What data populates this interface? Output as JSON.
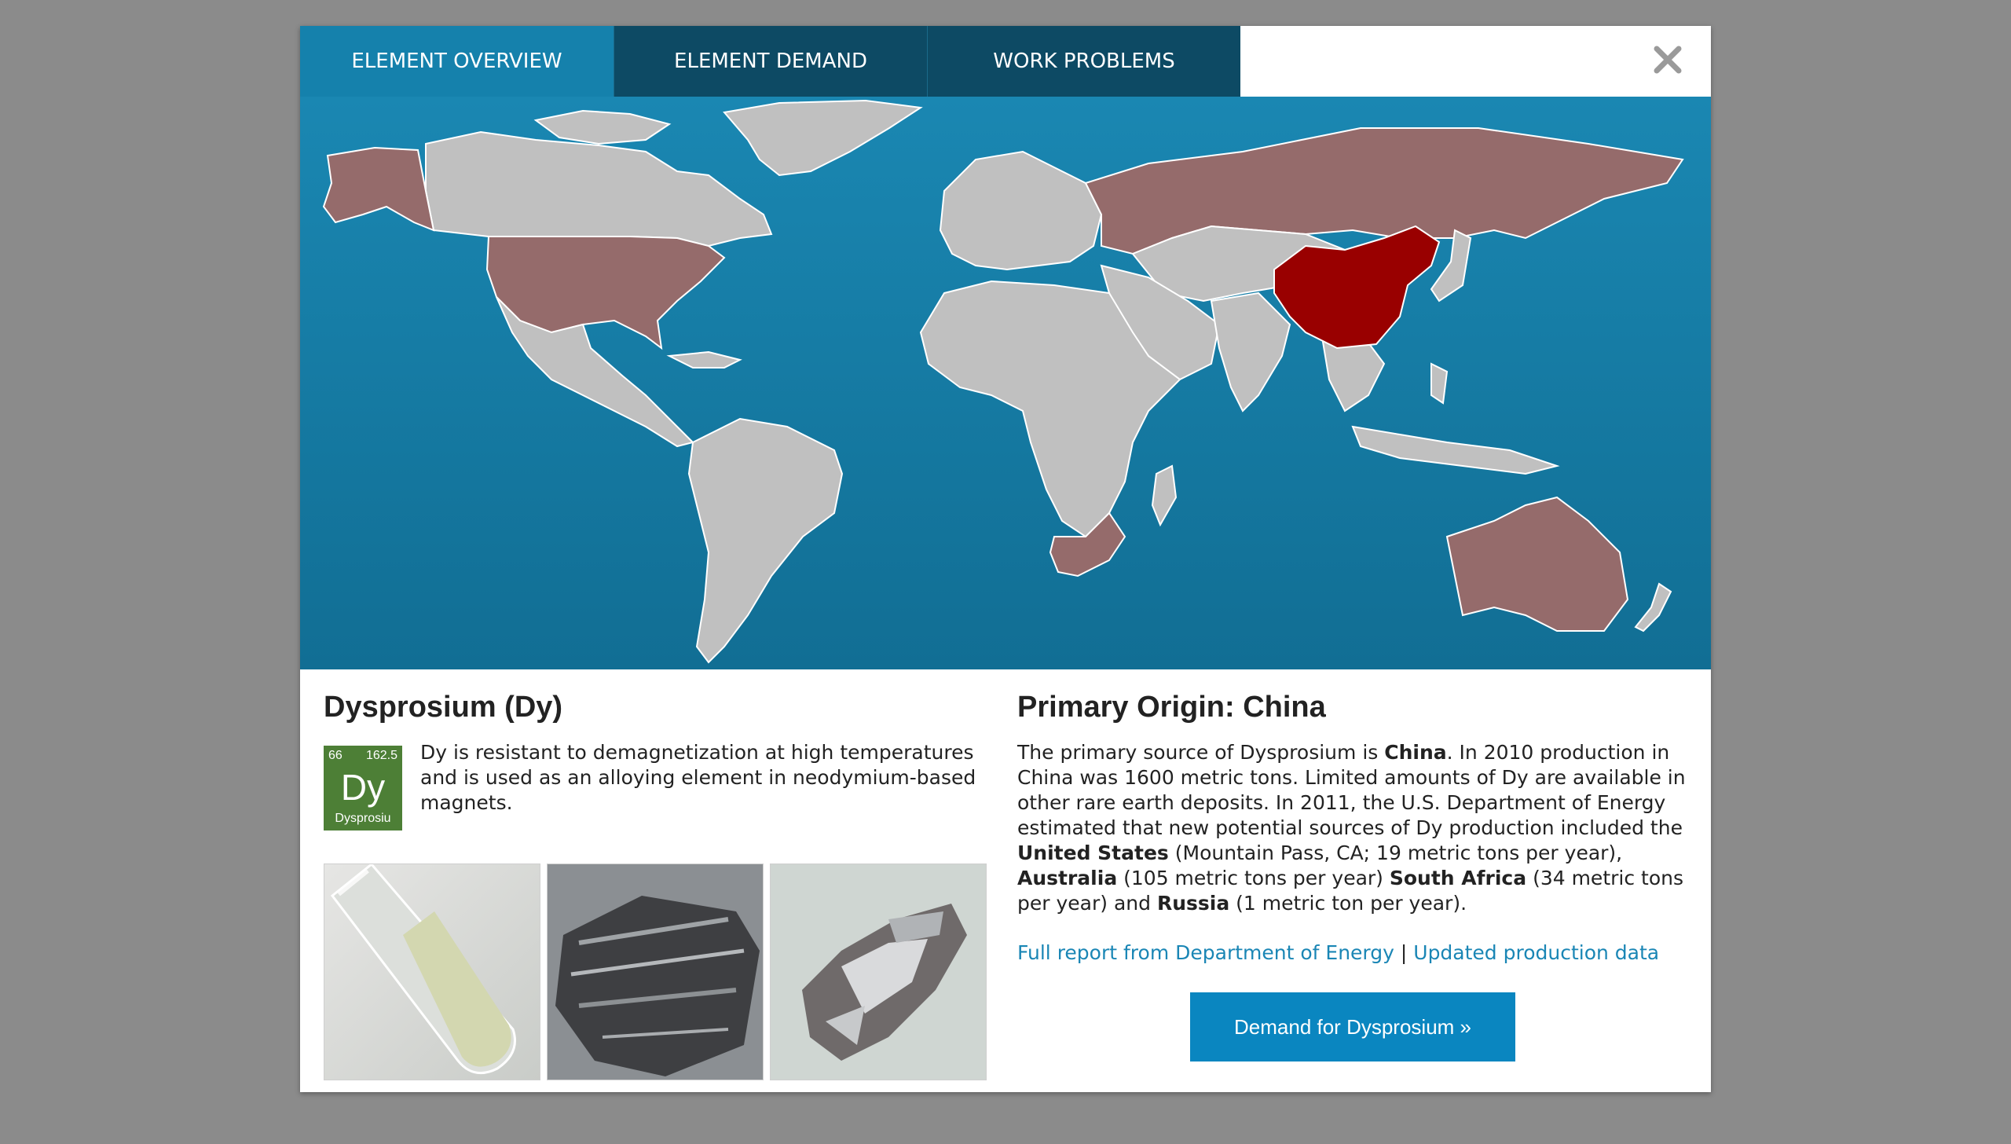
{
  "tabs": [
    {
      "label": "ELEMENT OVERVIEW",
      "active": true
    },
    {
      "label": "ELEMENT DEMAND",
      "active": false
    },
    {
      "label": "WORK PROBLEMS",
      "active": false
    }
  ],
  "close_icon": "close-x-icon",
  "map": {
    "primary_country": "China",
    "producing_countries": [
      "China",
      "United States",
      "Australia",
      "South Africa",
      "Russia"
    ],
    "colors": {
      "ocean": "#1581ac",
      "land": "#c0c0c0",
      "producer": "#956b6b",
      "primary": "#990000"
    }
  },
  "element": {
    "title": "Dysprosium (Dy)",
    "atomic_number": "66",
    "atomic_mass": "162.5",
    "symbol": "Dy",
    "name": "Dysprosiu",
    "tile_color": "#4d7f36",
    "description": "Dy is resistant to demagnetization at high temperatures and is used as an alloying element in neodymium-based magnets."
  },
  "origin": {
    "heading": "Primary Origin: China",
    "p1": "The primary source of Dysprosium is ",
    "b_china": "China",
    "p2": ". In 2010 production in China was 1600 metric tons. Limited amounts of Dy are available in other rare earth deposits. In 2011, the U.S. Department of Energy estimated that new potential sources of Dy production included the ",
    "b_us": "United States",
    "p3": " (Mountain Pass, CA; 19 metric tons per year), ",
    "b_au": "Australia",
    "p4": " (105 metric tons per year) ",
    "b_za": "South Africa",
    "p5": " (34 metric tons per year) and ",
    "b_ru": "Russia",
    "p6": " (1 metric ton per year).",
    "link1": "Full report from Department of Energy",
    "separator": "|",
    "link2": "Updated production data",
    "button": "Demand for Dysprosium »"
  }
}
